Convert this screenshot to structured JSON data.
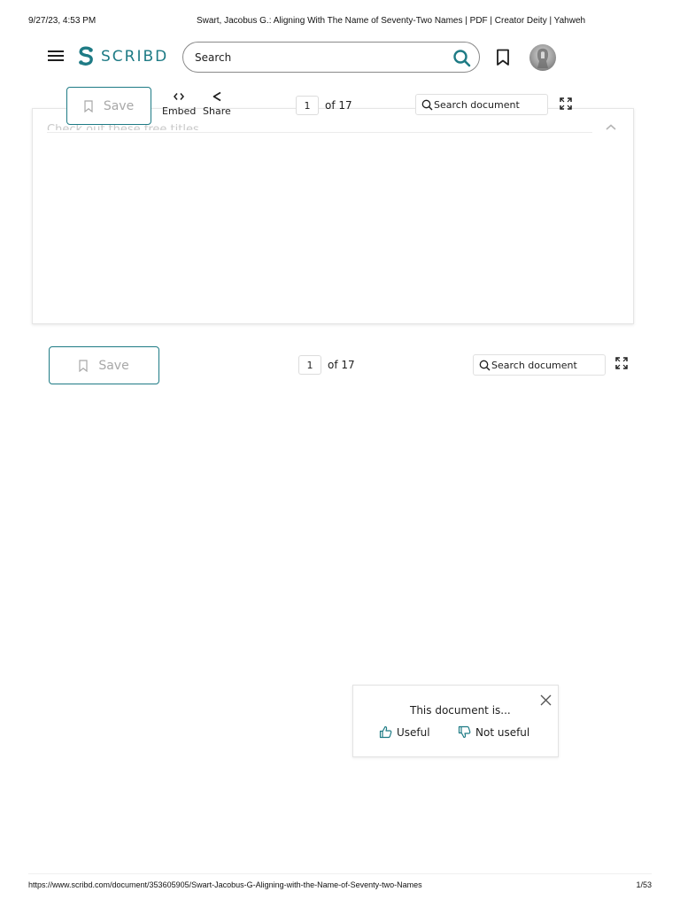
{
  "print": {
    "date": "9/27/23, 4:53 PM",
    "title": "Swart, Jacobus G.: Aligning With The Name of Seventy-Two Names | PDF | Creator Deity | Yahweh",
    "url": "https://www.scribd.com/document/353605905/Swart-Jacobus-G-Aligning-with-the-Name-of-Seventy-two-Names",
    "page": "1/53"
  },
  "nav": {
    "logo_text": "SCRIBD",
    "search_placeholder": "Search",
    "menu_icon": "hamburger-menu-icon",
    "bookmark_icon": "bookmark-icon",
    "search_icon": "search-icon"
  },
  "card_panel": {
    "heading": "Check out these free titles"
  },
  "toolbar_top": {
    "save_label": "Save",
    "embed_label": "Embed",
    "share_label": "Share",
    "page_value": "1",
    "page_of": "of 17",
    "search_placeholder": "Search document"
  },
  "toolbar_bottom": {
    "save_label": "Save",
    "page_value": "1",
    "page_of": "of 17",
    "search_placeholder": "Search document"
  },
  "feedback": {
    "title": "This document is...",
    "useful_label": "Useful",
    "not_useful_label": "Not useful"
  },
  "colors": {
    "brand": "#1e7b85",
    "text": "#1e1e1e",
    "muted": "#a8a8a8"
  }
}
